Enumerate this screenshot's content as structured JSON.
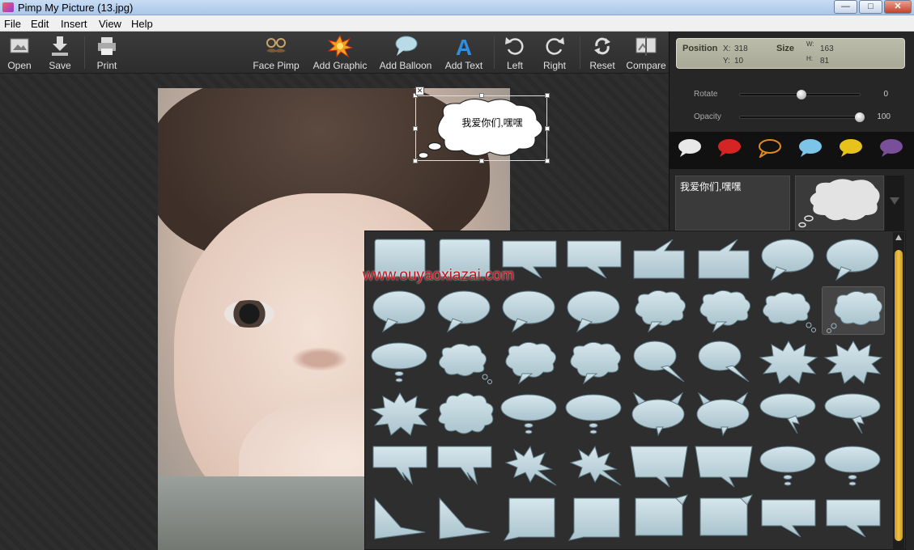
{
  "window": {
    "title": "Pimp My Picture (13.jpg)",
    "min": "—",
    "max": "□",
    "close": "✕"
  },
  "menu": [
    "File",
    "Edit",
    "Insert",
    "View",
    "Help"
  ],
  "toolbar": {
    "open": "Open",
    "save": "Save",
    "print": "Print",
    "face_pimp": "Face Pimp",
    "add_graphic": "Add Graphic",
    "add_balloon": "Add Balloon",
    "add_text": "Add Text",
    "left": "Left",
    "right": "Right",
    "reset": "Reset",
    "compare": "Compare"
  },
  "canvas": {
    "balloon_text": "我爱你们,嘿嘿",
    "watermark": "www.ouyaoxiazai.com"
  },
  "panel": {
    "position_label": "Position",
    "x_label": "X:",
    "x": "318",
    "y_label": "Y:",
    "y": "10",
    "size_label": "Size",
    "w_label": "W:",
    "w": "163",
    "h_label": "H:",
    "h": "81",
    "rotate_label": "Rotate",
    "rotate": "0",
    "opacity_label": "Opacity",
    "opacity": "100",
    "colors": [
      "#e8e8e8",
      "#d42424",
      "#e08a1e",
      "#7dc5e8",
      "#e8c21c",
      "#7a4f9a"
    ],
    "text_value": "我爱你们,嘿嘿"
  },
  "gallery": {
    "rows": [
      [
        "rect",
        "rect",
        "rect-tail",
        "rect-tail",
        "rect-top",
        "rect-top",
        "oval-tail",
        "oval-tail"
      ],
      [
        "oval-tail",
        "oval-tail",
        "oval-tail",
        "oval-tail",
        "cloud",
        "cloud",
        "cloud-dots",
        "cloud-dots-selected"
      ],
      [
        "oval-dots",
        "cloud-dots",
        "cloud",
        "cloud",
        "oval-tail-long",
        "oval-tail-long",
        "burst",
        "burst"
      ],
      [
        "burst",
        "cloud-burst",
        "oval-dots",
        "oval-dots",
        "devil",
        "devil",
        "oval-zig",
        "oval-zig"
      ],
      [
        "rect-zig",
        "rect-zig",
        "burst-zig",
        "burst-zig",
        "trapezoid",
        "trapezoid",
        "oval-dots",
        "oval-dots"
      ],
      [
        "triangle",
        "triangle",
        "rect-corner",
        "rect-corner",
        "rect-small",
        "rect-small",
        "rect-tail",
        "rect-tail"
      ]
    ]
  }
}
